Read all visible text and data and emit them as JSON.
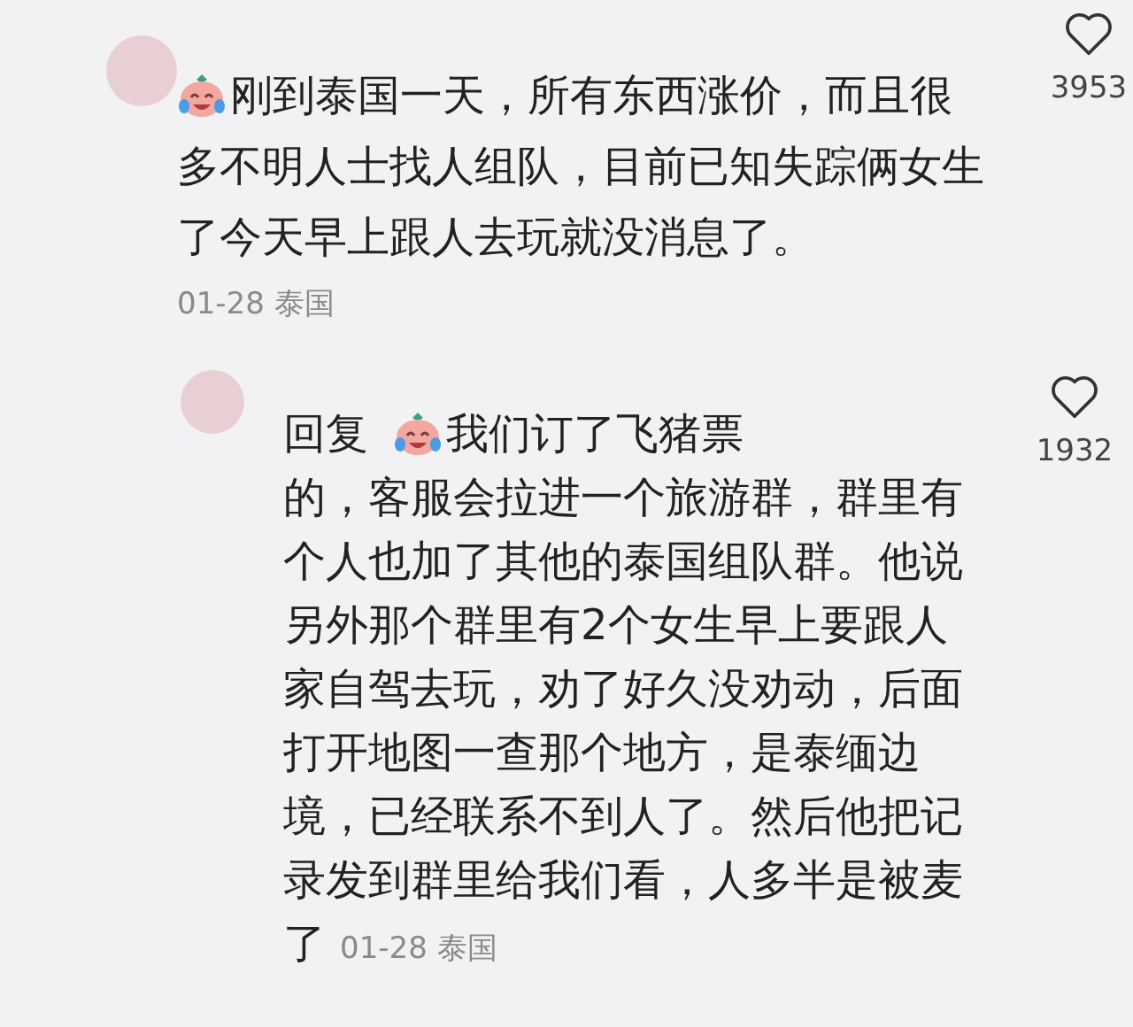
{
  "comments": [
    {
      "lines": [
        "刚到泰国一天，所有东西涨价，而且很",
        "多不明人士找人组队，目前已知失踪俩女生",
        "了今天早上跟人去玩就没消息了。"
      ],
      "date": "01-28 泰国",
      "likes": "3953",
      "liked": false,
      "replies": [
        {
          "prefix": "回复",
          "lines": [
            "我们订了飞猪票",
            "的，客服会拉进一个旅游群，群里有",
            "个人也加了其他的泰国组队群。他说",
            "另外那个群里有2个女生早上要跟人",
            "家自驾去玩，劝了好久没劝动，后面",
            "打开地图一查那个地方，是泰缅边",
            "境，已经联系不到人了。然后他把记",
            "录发到群里给我们看，人多半是被麦",
            "了"
          ],
          "date": "01-28 泰国",
          "likes": "1932",
          "liked": false
        }
      ]
    }
  ]
}
